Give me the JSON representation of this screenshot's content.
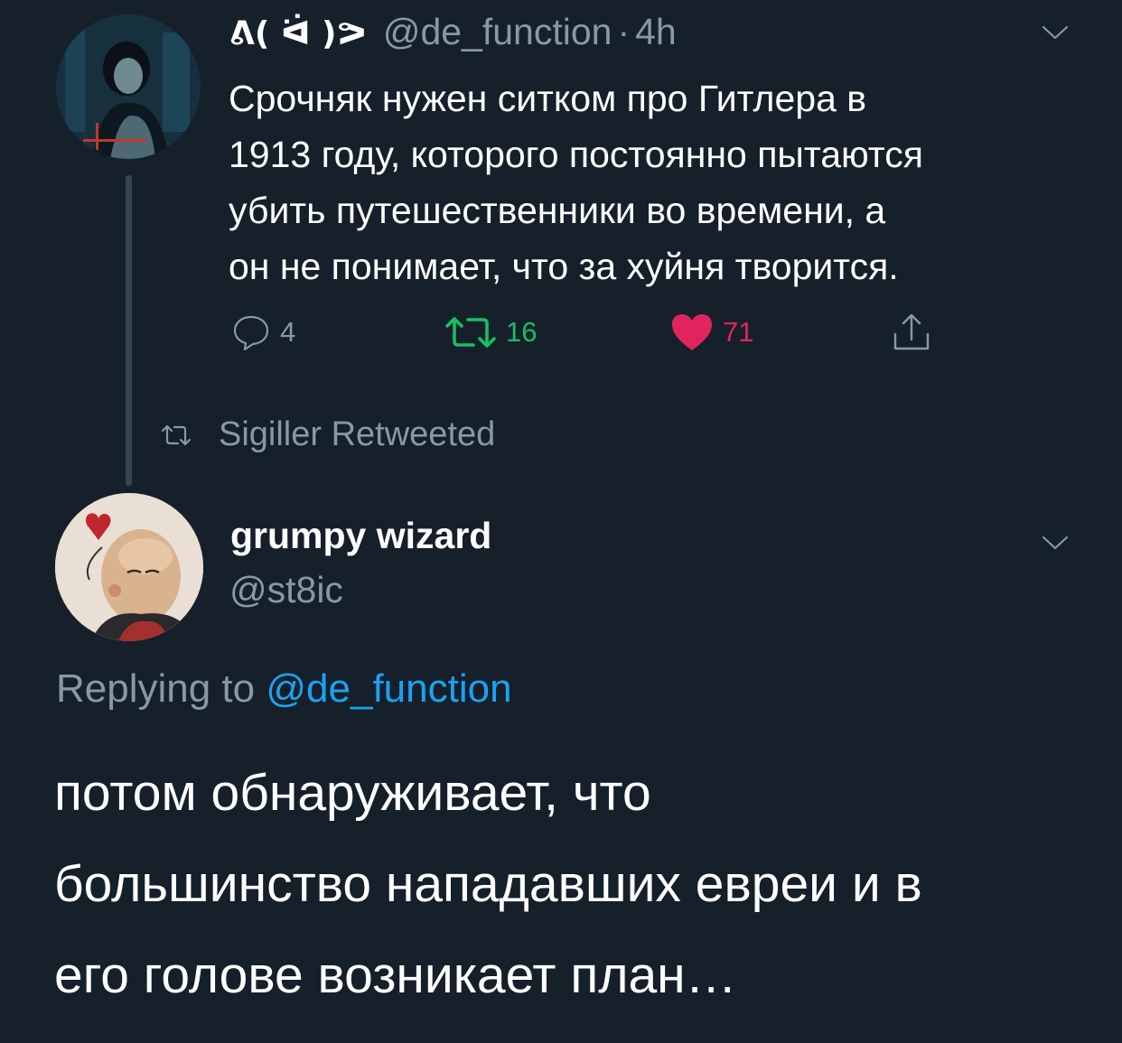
{
  "tweet": {
    "author_name": "ᕕ( ᐛ )ᕗ",
    "author_handle": "@de_function",
    "separator": "·",
    "time": "4h",
    "text_lines": [
      "Срочняк нужен ситком про Гитлера в",
      "1913 году, которого постоянно пытаются",
      "убить путешественники во времени, а",
      "он не понимает, что за хуйня творится."
    ],
    "reply_count": "4",
    "retweet_count": "16",
    "like_count": "71",
    "liked": true,
    "retweeted": true
  },
  "retweeted_by": {
    "label": "Sigiller Retweeted"
  },
  "reply": {
    "author_name": "grumpy wizard",
    "author_handle": "@st8ic",
    "replying_prefix": "Replying to",
    "replying_to": "@de_function",
    "text_lines": [
      "потом обнаруживает, что",
      "большинство нападавших евреи и в",
      "его голове возникает план…"
    ]
  },
  "colors": {
    "background": "#15202b",
    "secondary_text": "#8899a6",
    "link": "#1da1f2",
    "retweet_active": "#17bf63",
    "like_active": "#e0245e"
  },
  "icons": {
    "reply": "reply-icon",
    "retweet": "retweet-icon",
    "like": "heart-icon",
    "share": "share-icon",
    "menu": "chevron-down-icon"
  }
}
